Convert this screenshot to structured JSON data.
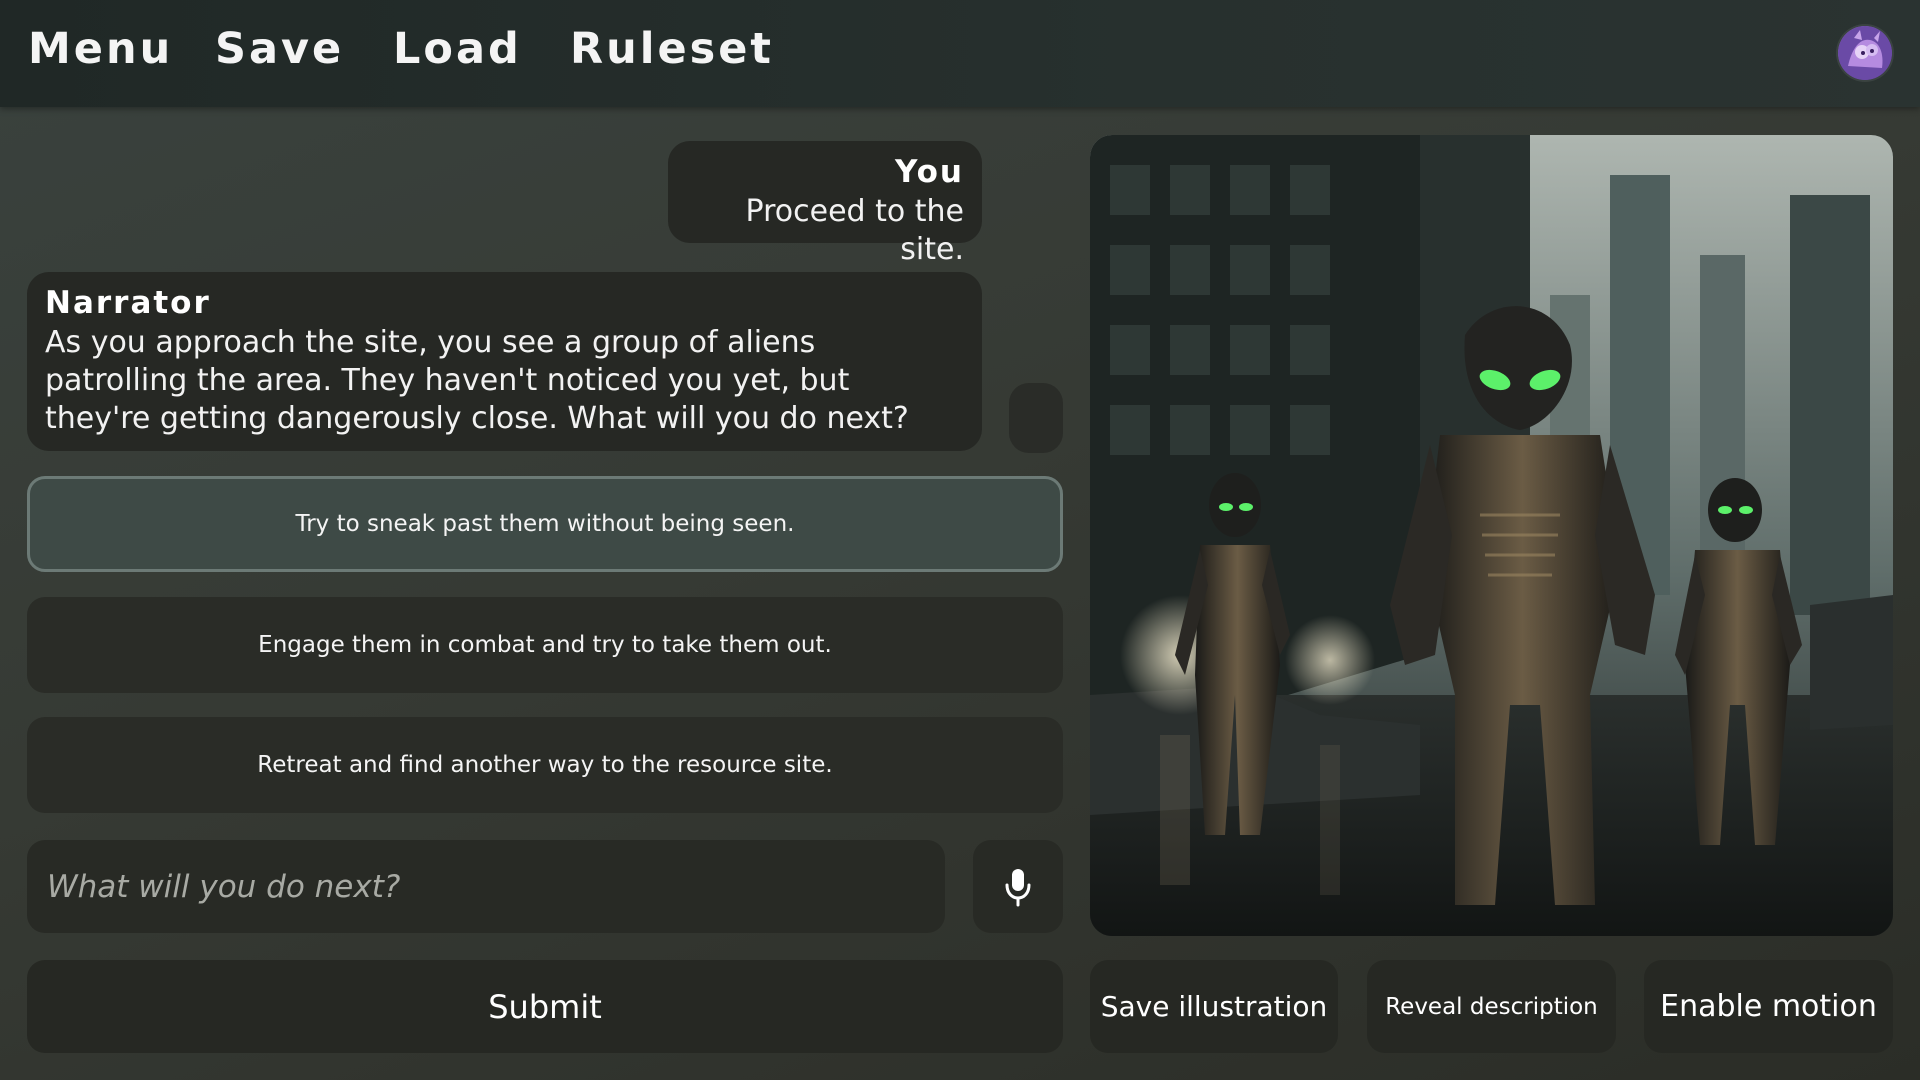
{
  "nav": {
    "menu": "Menu",
    "save": "Save",
    "load": "Load",
    "ruleset": "Ruleset"
  },
  "chat": {
    "user": {
      "speaker": "You",
      "text": "Proceed to the site."
    },
    "narrator": {
      "speaker": "Narrator",
      "text": "As you approach the site, you see a group of aliens patrolling the area. They haven't noticed you yet, but they're getting dangerously close. What will you do next?"
    }
  },
  "choices": [
    {
      "label": "Try to sneak past them without being seen.",
      "selected": true
    },
    {
      "label": "Engage them in combat and try to take them out.",
      "selected": false
    },
    {
      "label": "Retreat and find another way to the resource site.",
      "selected": false
    }
  ],
  "input": {
    "placeholder": "What will you do next?",
    "value": ""
  },
  "submit_label": "Submit",
  "illustration_actions": {
    "save": "Save illustration",
    "reveal": "Reveal description",
    "motion": "Enable motion"
  },
  "icons": {
    "mic": "microphone-icon",
    "avatar": "user-avatar"
  },
  "colors": {
    "background": "#363a34",
    "topbar": "#222a28",
    "bubble": "#262824",
    "selected_choice": "#3e4a46",
    "alien_eyes": "#5cf06a"
  }
}
